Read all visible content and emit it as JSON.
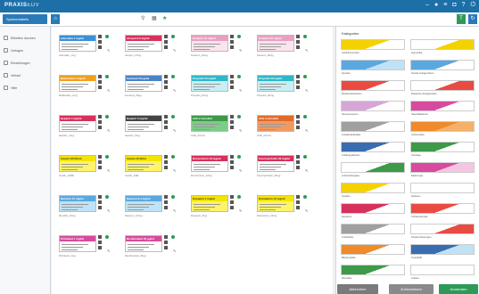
{
  "titlebar": {
    "brand_bold": "PRAXIS",
    "brand_thin": "EDV",
    "icons": [
      "minus-icon",
      "user-icon",
      "menu-icon",
      "cart-icon",
      "help-icon",
      "power-icon"
    ]
  },
  "toolbar": {
    "selected_label": "Spritzenlabels",
    "filter_label": "T",
    "refresh_icon": "refresh-icon"
  },
  "sidebar": {
    "items": [
      {
        "label": "Etiketten drucken"
      },
      {
        "label": "Vorlagen"
      },
      {
        "label": "Einstellungen"
      },
      {
        "label": "Verlauf"
      },
      {
        "label": "Hilfe"
      }
    ]
  },
  "labels": [
    {
      "name": "Adrenalin 1 mg/ml",
      "head_color": "#3a8fd6",
      "bg": "#ffffff",
      "caption": "Adrenalin_1mg"
    },
    {
      "name": "Atropin 0,5 mg/ml",
      "head_color": "#d8305c",
      "bg": "#ffffff",
      "caption": "Atropin_0,5mg"
    },
    {
      "name": "Ketamin 10 mg/ml",
      "head_color": "#e9a0c0",
      "bg": "#fbe4ef",
      "caption": "Ketamin_10mg"
    },
    {
      "name": "Ketamin 50 mg/ml",
      "head_color": "#e9a0c0",
      "bg": "#fbe4ef",
      "caption": "Ketamin_50mg"
    },
    {
      "name": "Midazolam 1 mg/ml",
      "head_color": "#f0a020",
      "bg": "#ffffff",
      "caption": "Midazolam_1mg"
    },
    {
      "name": "Fentanyl 50 µg/ml",
      "head_color": "#4a82c8",
      "bg": "#ffffff",
      "caption": "Fentanyl_50µg"
    },
    {
      "name": "Propofol 10 mg/ml",
      "head_color": "#30b7c8",
      "bg": "#c8eef3",
      "caption": "Propofol_10mg"
    },
    {
      "name": "Propofol 20 mg/ml",
      "head_color": "#30b7c8",
      "bg": "#c8eef3",
      "caption": "Propofol_20mg"
    },
    {
      "name": "Heparin 1 mg/ml",
      "head_color": "#d8305c",
      "bg": "#ffffff",
      "caption": "Heparin_1mg"
    },
    {
      "name": "Heparin 5 mg/ml",
      "head_color": "#444444",
      "bg": "#ffffff",
      "caption": "Heparin_5mg"
    },
    {
      "name": "ACE 2 mmol/ml",
      "head_color": "#3c9a48",
      "bg": "#7ccd88",
      "caption": "ACE_2mmol"
    },
    {
      "name": "ACE 4 mmol/ml",
      "head_color": "#e36a2a",
      "bg": "#f19a60",
      "caption": "ACE_4mmol"
    },
    {
      "name": "Insulin 100 IE/ml",
      "head_color": "#f5e400",
      "bg": "#fff36a",
      "caption": "Insulin_100IE"
    },
    {
      "name": "Insulin 40 IE/ml",
      "head_color": "#f5e400",
      "bg": "#fff36a",
      "caption": "Insulin_40IE"
    },
    {
      "name": "Rocuronium 10 mg/ml",
      "head_color": "#d8305c",
      "bg": "#ffffff",
      "caption": "Rocuronium_10mg"
    },
    {
      "name": "Succinylcholin 20 mg/ml",
      "head_color": "#d8305c",
      "bg": "#ffffff",
      "caption": "Succinylcholin_20mg"
    },
    {
      "name": "Morphin 10 mg/ml",
      "head_color": "#5aa8e0",
      "bg": "#bfe2f7",
      "caption": "Morphin_10mg"
    },
    {
      "name": "Naloxon 0,4 mg/ml",
      "head_color": "#5aa8e0",
      "bg": "#bfe2f7",
      "caption": "Naloxon_0,4mg"
    },
    {
      "name": "Dopamin 5 mg/ml",
      "head_color": "#f5e400",
      "bg": "#fff36a",
      "caption": "Dopamin_5mg"
    },
    {
      "name": "Dobutamin 12 mg/ml",
      "head_color": "#f5e400",
      "bg": "#fff36a",
      "caption": "Dobutamin_12mg"
    },
    {
      "name": "Piritramid 1 mg/ml",
      "head_color": "#d84aa0",
      "bg": "#ffffff",
      "caption": "Piritramid_1mg"
    },
    {
      "name": "Remifentanil 20 µg/ml",
      "head_color": "#d84aa0",
      "bg": "#ffffff",
      "caption": "Remifentanil_20µg"
    }
  ],
  "categories_panel": {
    "title": "Kategorien",
    "items": [
      {
        "label": "Induktionsmittel",
        "colors": [
          "#f4d200",
          "#ffffff"
        ]
      },
      {
        "label": "Hypnotika",
        "colors": [
          "#ffffff",
          "#f4d200"
        ]
      },
      {
        "label": "Opioide",
        "colors": [
          "#5aa8e0",
          "#bfe2f7"
        ]
      },
      {
        "label": "Opioid-Antagonisten",
        "colors": [
          "#5aa8e0",
          "#ffffff"
        ]
      },
      {
        "label": "Muskelrelaxantien",
        "colors": [
          "#e94b43",
          "#ffffff"
        ]
      },
      {
        "label": "Relaxans-Antagonisten",
        "colors": [
          "#ffffff",
          "#e94b43"
        ]
      },
      {
        "label": "Vasopressoren",
        "colors": [
          "#d6a6d6",
          "#ffffff"
        ]
      },
      {
        "label": "Vasodilatatoren",
        "colors": [
          "#d84aa0",
          "#ffffff"
        ]
      },
      {
        "label": "Lokalanästhetika",
        "colors": [
          "#a0a0a0",
          "#ffffff"
        ]
      },
      {
        "label": "Antiemetika",
        "colors": [
          "#f08a2a",
          "#f5b06a"
        ]
      },
      {
        "label": "Antikoagulantien",
        "colors": [
          "#3a6cb0",
          "#ffffff"
        ]
      },
      {
        "label": "Sonstige",
        "colors": [
          "#3c9a48",
          "#ffffff"
        ]
      },
      {
        "label": "Anticholinergika",
        "colors": [
          "#ffffff",
          "#3c9a48"
        ]
      },
      {
        "label": "Elektrolyte",
        "colors": [
          "#d84aa0",
          "#f5c6e2"
        ]
      },
      {
        "label": "Insuline",
        "colors": [
          "#f4d200",
          "#ffffff"
        ]
      },
      {
        "label": "Glukose",
        "colors": [
          "#ffffff",
          "#ffffff"
        ]
      },
      {
        "label": "Heparine",
        "colors": [
          "#d8305c",
          "#ffffff"
        ]
      },
      {
        "label": "Kortikosteroide",
        "colors": [
          "#e94b43",
          "#ffffff"
        ]
      },
      {
        "label": "Antibiotika",
        "colors": [
          "#a0a0a0",
          "#ffffff"
        ]
      },
      {
        "label": "Infusionslösungen",
        "colors": [
          "#ffffff",
          "#e94b43"
        ]
      },
      {
        "label": "Blutprodukte",
        "colors": [
          "#f08a2a",
          "#ffffff"
        ]
      },
      {
        "label": "Impfstoffe",
        "colors": [
          "#3a6cb0",
          "#bfe2f7"
        ]
      },
      {
        "label": "Diuretika",
        "colors": [
          "#3c9a48",
          "#ffffff"
        ]
      },
      {
        "label": "Andere",
        "colors": [
          "#ffffff",
          "#ffffff"
        ]
      }
    ]
  },
  "footer": {
    "cancel": "Abbrechen",
    "reset": "Zurücksetzen",
    "apply": "Anwenden"
  },
  "colors": {
    "accent": "#1d6fa8",
    "footer_cancel": "#7a7a7a",
    "footer_reset": "#8a8a8a",
    "footer_apply": "#2e9a58"
  }
}
